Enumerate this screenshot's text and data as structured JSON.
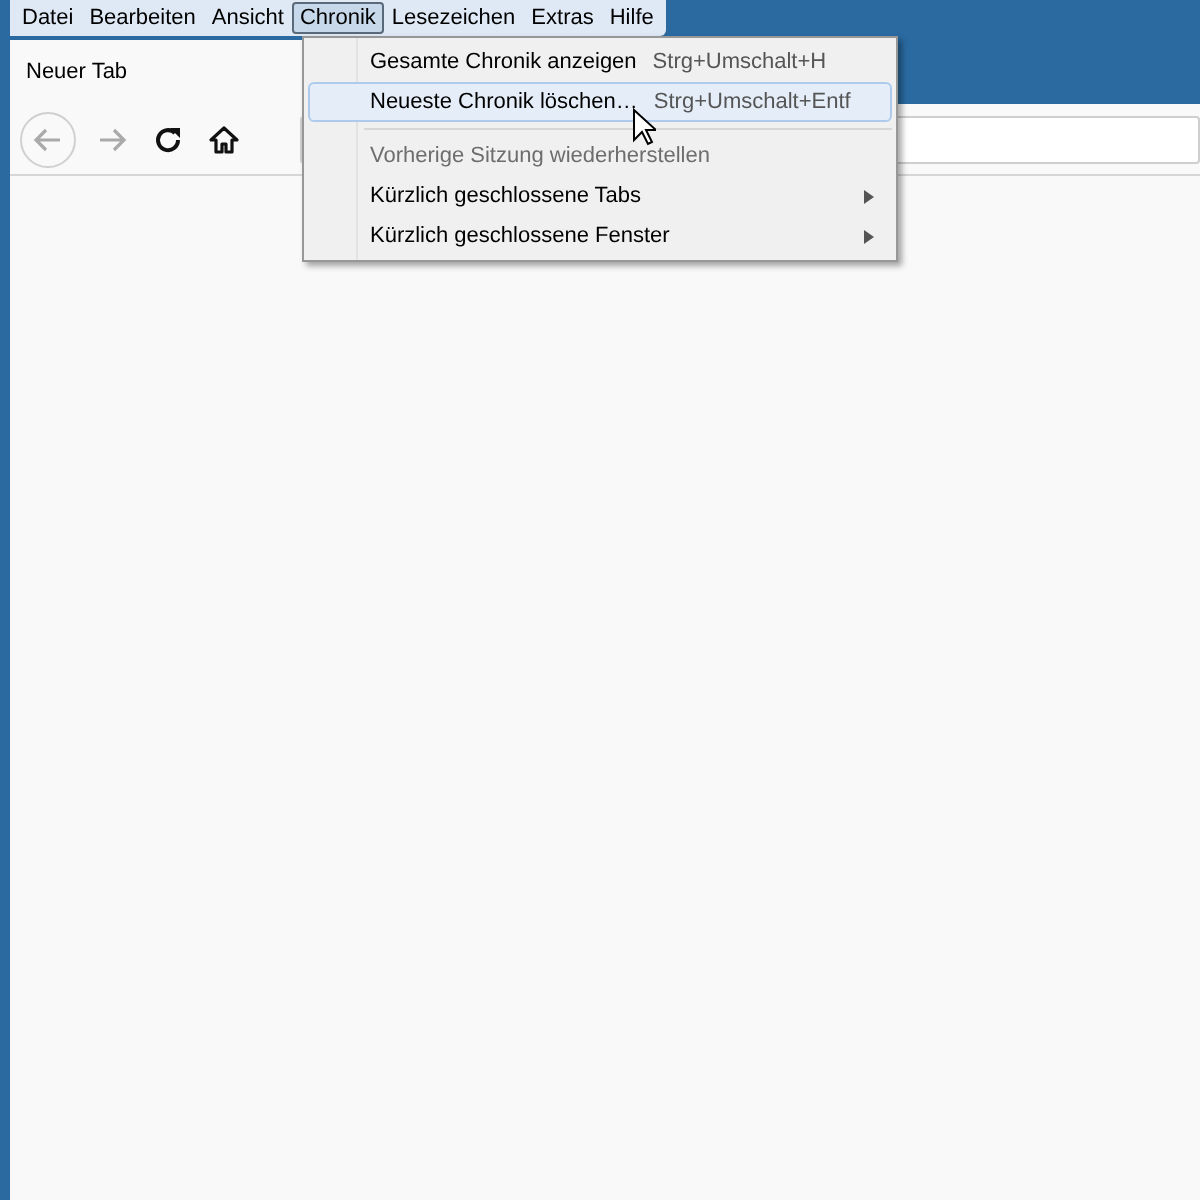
{
  "menu_bar": [
    {
      "label": "Datei",
      "selected": false
    },
    {
      "label": "Bearbeiten",
      "selected": false
    },
    {
      "label": "Ansicht",
      "selected": false
    },
    {
      "label": "Chronik",
      "selected": true
    },
    {
      "label": "Lesezeichen",
      "selected": false
    },
    {
      "label": "Extras",
      "selected": false
    },
    {
      "label": "Hilfe",
      "selected": false
    }
  ],
  "tabs": [
    {
      "label": "Neuer Tab",
      "selected": true
    }
  ],
  "nav": {
    "back_disabled": true,
    "forward_disabled": true
  },
  "menu": [
    {
      "kind": "item",
      "label": "Gesamte Chronik anzeigen",
      "shortcut": "Strg+Umschalt+H",
      "selected": false,
      "disabled": false,
      "submenu": false
    },
    {
      "kind": "item",
      "label": "Neueste Chronik löschen…",
      "shortcut": "Strg+Umschalt+Entf",
      "selected": true,
      "disabled": false,
      "submenu": false
    },
    {
      "kind": "separator"
    },
    {
      "kind": "item",
      "label": "Vorherige Sitzung wiederherstellen",
      "selected": false,
      "disabled": true,
      "submenu": false
    },
    {
      "kind": "item",
      "label": "Kürzlich geschlossene Tabs",
      "selected": false,
      "disabled": false,
      "submenu": true
    },
    {
      "kind": "item",
      "label": "Kürzlich geschlossene Fenster",
      "selected": false,
      "disabled": false,
      "submenu": true
    }
  ]
}
